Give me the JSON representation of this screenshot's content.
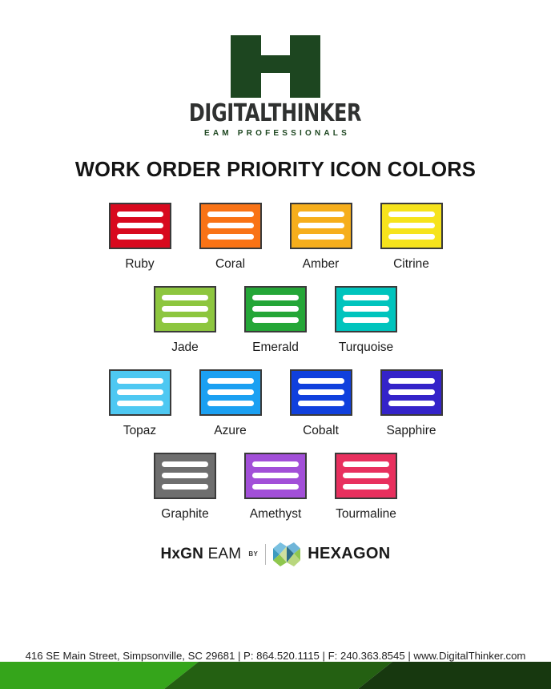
{
  "brand": {
    "logo_icon": "h-block-logo",
    "logo_color": "#1d4620",
    "wordmark": "DIGITALTHINKER",
    "wordmark_color": "#2f3130",
    "tagline": "EAM PROFESSIONALS",
    "tagline_color": "#1d4620"
  },
  "title": "WORK ORDER PRIORITY ICON COLORS",
  "swatches": {
    "icon_border_color": "#3a3a3a",
    "icon_line_color": "#ffffff",
    "lines_per_icon": 3,
    "rows": [
      {
        "items": [
          {
            "label": "Ruby",
            "color": "#d8091e"
          },
          {
            "label": "Coral",
            "color": "#f97316"
          },
          {
            "label": "Amber",
            "color": "#f6ae1c"
          },
          {
            "label": "Citrine",
            "color": "#f6e31c"
          }
        ]
      },
      {
        "items": [
          {
            "label": "Jade",
            "color": "#8dc63f"
          },
          {
            "label": "Emerald",
            "color": "#24a637"
          },
          {
            "label": "Turquoise",
            "color": "#00c4bd"
          }
        ]
      },
      {
        "items": [
          {
            "label": "Topaz",
            "color": "#4ec8f2"
          },
          {
            "label": "Azure",
            "color": "#1ba0f2"
          },
          {
            "label": "Cobalt",
            "color": "#1040dd"
          },
          {
            "label": "Sapphire",
            "color": "#3423c9"
          }
        ]
      },
      {
        "items": [
          {
            "label": "Graphite",
            "color": "#6e6e6e"
          },
          {
            "label": "Amethyst",
            "color": "#a24fd8"
          },
          {
            "label": "Tourmaline",
            "color": "#e8305e"
          }
        ]
      }
    ]
  },
  "footer": {
    "hxgn_bold": "HxGN",
    "hxgn_light": "EAM",
    "by": "BY",
    "hexagon_mark_icon": "hexagon-facet-logo",
    "hexagon_word": "HEXAGON",
    "address": "416 SE Main Street, Simpsonville, SC 29681 | P: 864.520.1115 | F: 240.363.8545 | www.DigitalThinker.com",
    "stripe_colors": {
      "light": "#35a51b",
      "mid": "#246012",
      "dark": "#17380f"
    }
  }
}
